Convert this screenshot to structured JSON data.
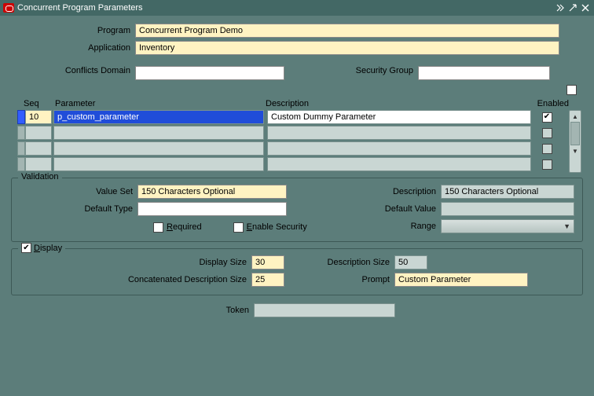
{
  "title": "Concurrent Program Parameters",
  "top": {
    "program_label": "Program",
    "program_value": "Concurrent Program Demo",
    "application_label": "Application",
    "application_value": "Inventory",
    "conflicts_label": "Conflicts Domain",
    "conflicts_value": "",
    "security_label": "Security Group",
    "security_value": ""
  },
  "grid": {
    "hdr_seq": "Seq",
    "hdr_param": "Parameter",
    "hdr_desc": "Description",
    "hdr_enabled": "Enabled",
    "rows": [
      {
        "seq": "10",
        "param": "p_custom_parameter",
        "desc": "Custom Dummy Parameter",
        "enabled": true
      },
      {
        "seq": "",
        "param": "",
        "desc": "",
        "enabled": false
      },
      {
        "seq": "",
        "param": "",
        "desc": "",
        "enabled": false
      },
      {
        "seq": "",
        "param": "",
        "desc": "",
        "enabled": false
      }
    ]
  },
  "validation": {
    "legend": "Validation",
    "value_set_label": "Value Set",
    "value_set": "150 Characters Optional",
    "description_label": "Description",
    "description": "150 Characters Optional",
    "default_type_label": "Default Type",
    "default_type": "",
    "default_value_label": "Default Value",
    "default_value": "",
    "required_label": "Required",
    "enable_security_label": "Enable Security",
    "range_label": "Range"
  },
  "display": {
    "legend": "Display",
    "display_checked": true,
    "display_size_label": "Display Size",
    "display_size": "30",
    "description_size_label": "Description Size",
    "description_size": "50",
    "concat_label": "Concatenated Description Size",
    "concat_size": "25",
    "prompt_label": "Prompt",
    "prompt": "Custom Parameter"
  },
  "token": {
    "label": "Token",
    "value": ""
  }
}
